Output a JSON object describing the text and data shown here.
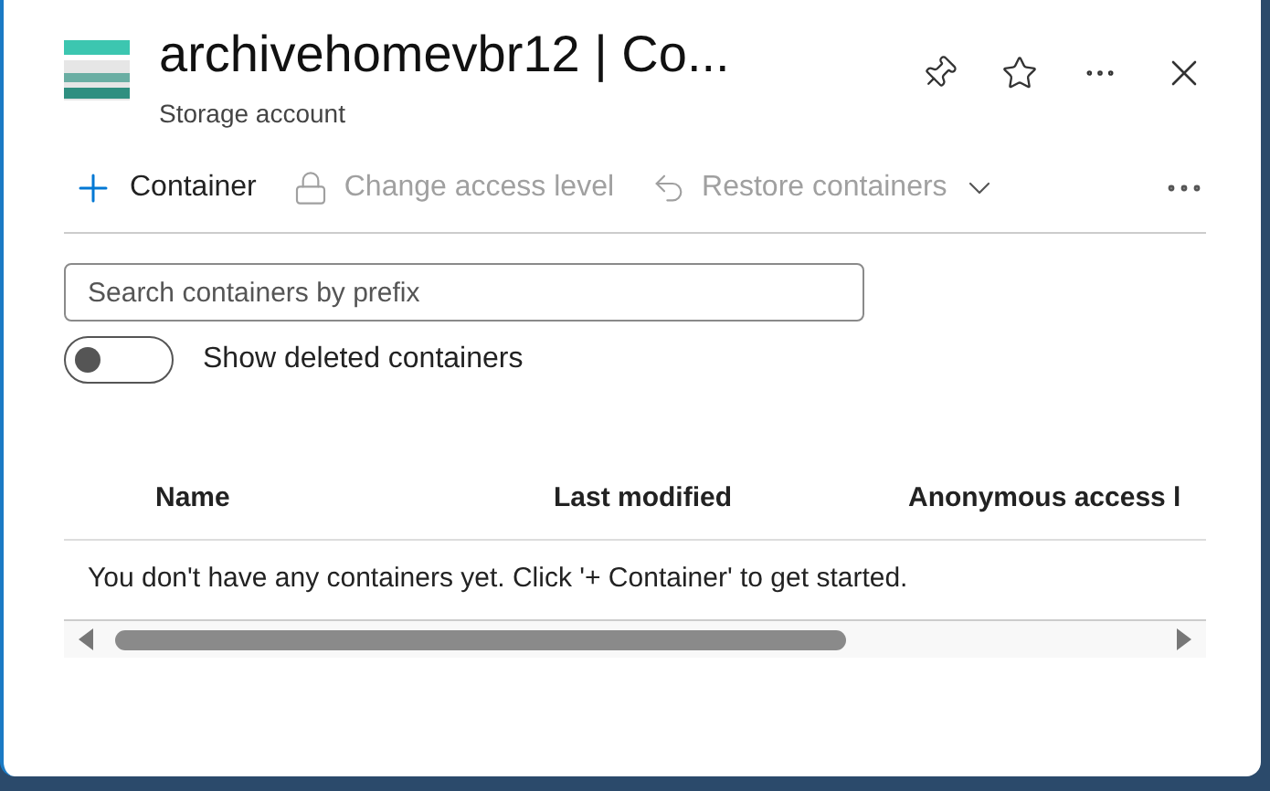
{
  "header": {
    "title": "archivehomevbr12 | Co...",
    "subtitle": "Storage account"
  },
  "toolbar": [
    {
      "kind": "add",
      "label": "Container",
      "disabled": false
    },
    {
      "kind": "lock",
      "label": "Change access level",
      "disabled": true
    },
    {
      "kind": "restore",
      "label": "Restore containers",
      "disabled": true
    }
  ],
  "search": {
    "placeholder": "Search containers by prefix"
  },
  "toggle": {
    "label": "Show deleted containers",
    "on": false
  },
  "table": {
    "columns": [
      "Name",
      "Last modified",
      "Anonymous access l"
    ],
    "empty_message": "You don't have any containers yet. Click '+ Container' to get started."
  }
}
